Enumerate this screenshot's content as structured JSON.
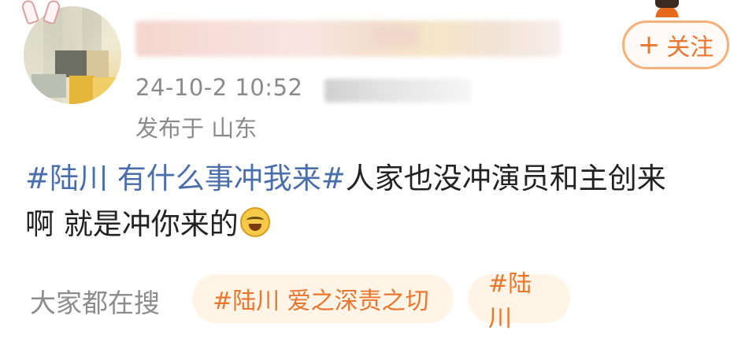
{
  "post": {
    "timestamp": "24-10-2 10:52",
    "location": "发布于 山东",
    "hashtag": "#陆川 有什么事冲我来#",
    "body_line1": "人家也没冲演员和主创来",
    "body_line2": "啊 就是冲你来的",
    "emoji": "laughing-crying-emoji"
  },
  "actions": {
    "follow_plus": "+",
    "follow_label": "关注"
  },
  "search": {
    "label": "大家都在搜",
    "chips": [
      "#陆川 爱之深责之切",
      "#陆川"
    ]
  },
  "colors": {
    "accent": "#e8762e",
    "hashtag": "#4a6ea9",
    "muted": "#8a8a8a"
  }
}
